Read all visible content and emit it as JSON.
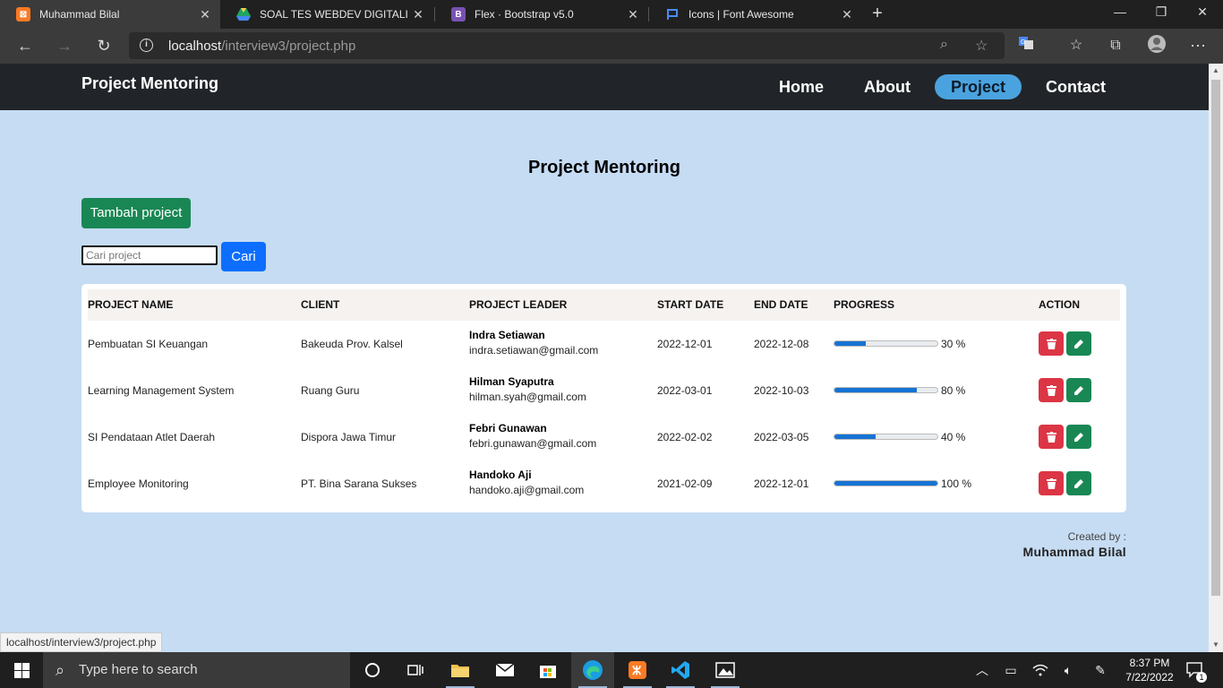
{
  "browser": {
    "tabs": [
      {
        "title": "Muhammad Bilal",
        "icon": "xampp-icon",
        "active": true
      },
      {
        "title": "SOAL TES WEBDEV DIGITALIZ BA",
        "icon": "google-drive-icon",
        "active": false
      },
      {
        "title": "Flex · Bootstrap v5.0",
        "icon": "bootstrap-icon",
        "active": false
      },
      {
        "title": "Icons | Font Awesome",
        "icon": "font-awesome-flag-icon",
        "active": false
      }
    ],
    "url_host": "localhost",
    "url_path": "/interview3/project.php",
    "status_url": "localhost/interview3/project.php"
  },
  "navbar": {
    "brand": "Project Mentoring",
    "links": [
      {
        "label": "Home",
        "active": false
      },
      {
        "label": "About",
        "active": false
      },
      {
        "label": "Project",
        "active": true
      },
      {
        "label": "Contact",
        "active": false
      }
    ]
  },
  "main": {
    "title": "Project Mentoring",
    "add_button": "Tambah project",
    "search_placeholder": "Cari project",
    "search_button": "Cari"
  },
  "table": {
    "headers": [
      "Project Name",
      "Client",
      "Project Leader",
      "Start Date",
      "End Date",
      "Progress",
      "Action"
    ],
    "rows": [
      {
        "name": "Pembuatan SI Keuangan",
        "client": "Bakeuda Prov. Kalsel",
        "leader_name": "Indra Setiawan",
        "leader_email": "indra.setiawan@gmail.com",
        "start": "2022-12-01",
        "end": "2022-12-08",
        "progress": 30,
        "progress_label": "30 %"
      },
      {
        "name": "Learning Management System",
        "client": "Ruang Guru",
        "leader_name": "Hilman Syaputra",
        "leader_email": "hilman.syah@gmail.com",
        "start": "2022-03-01",
        "end": "2022-10-03",
        "progress": 80,
        "progress_label": "80 %"
      },
      {
        "name": "SI Pendataan Atlet Daerah",
        "client": "Dispora Jawa Timur",
        "leader_name": "Febri Gunawan",
        "leader_email": "febri.gunawan@gmail.com",
        "start": "2022-02-02",
        "end": "2022-03-05",
        "progress": 40,
        "progress_label": "40 %"
      },
      {
        "name": "Employee Monitoring",
        "client": "PT. Bina Sarana Sukses",
        "leader_name": "Handoko Aji",
        "leader_email": "handoko.aji@gmail.com",
        "start": "2021-02-09",
        "end": "2022-12-01",
        "progress": 100,
        "progress_label": "100 %"
      }
    ]
  },
  "footer": {
    "created_by": "Created by :",
    "author": "Muhammad Bilal"
  },
  "taskbar": {
    "search_placeholder": "Type here to search",
    "time": "8:37 PM",
    "date": "7/22/2022",
    "notification_count": "1"
  },
  "colors": {
    "page_bg": "#c6dcf3",
    "navbar_bg": "#212529",
    "nav_active": "#4aa3df",
    "success": "#198754",
    "primary": "#0d6efd",
    "danger": "#dc3545"
  }
}
